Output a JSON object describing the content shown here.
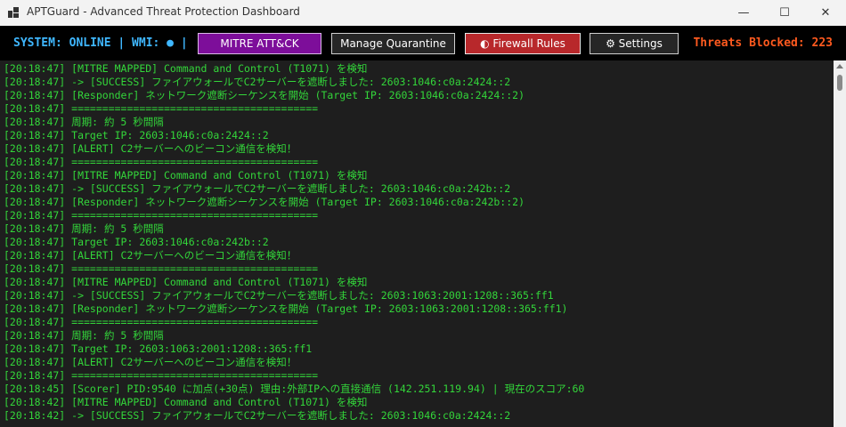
{
  "window": {
    "title": "APTGuard - Advanced Threat Protection Dashboard",
    "minimize_glyph": "—",
    "maximize_glyph": "☐",
    "close_glyph": "✕"
  },
  "toolbar": {
    "status_text": "SYSTEM: ONLINE | WMI: ● |",
    "mitre_label": "MITRE ATT&CK",
    "quarantine_label": "Manage Quarantine",
    "firewall_label": "◐ Firewall Rules",
    "settings_label": "⚙ Settings",
    "threats_text": "Threats Blocked: 223"
  },
  "colors": {
    "log_text": "#33d63a",
    "status_text": "#3fb7ff",
    "threats_text": "#ff5a1f",
    "mitre_button": "#7d0e9a",
    "firewall_button": "#b8282b"
  },
  "log_lines": [
    "[20:18:47] [MITRE MAPPED] Command and Control (T1071) を検知",
    "[20:18:47]   -> [SUCCESS] ファイアウォールでC2サーバーを遮断しました: 2603:1046:c0a:2424::2",
    "[20:18:47] [Responder] ネットワーク遮断シーケンスを開始 (Target IP: 2603:1046:c0a:2424::2)",
    "[20:18:47] ========================================",
    "[20:18:47]   周期: 約 5 秒間隔",
    "[20:18:47]   Target IP: 2603:1046:c0a:2424::2",
    "[20:18:47] [ALERT] C2サーバーへのビーコン通信を検知！",
    "[20:18:47] ========================================",
    "[20:18:47] [MITRE MAPPED] Command and Control (T1071) を検知",
    "[20:18:47]   -> [SUCCESS] ファイアウォールでC2サーバーを遮断しました: 2603:1046:c0a:242b::2",
    "[20:18:47] [Responder] ネットワーク遮断シーケンスを開始 (Target IP: 2603:1046:c0a:242b::2)",
    "[20:18:47] ========================================",
    "[20:18:47]   周期: 約 5 秒間隔",
    "[20:18:47]   Target IP: 2603:1046:c0a:242b::2",
    "[20:18:47] [ALERT] C2サーバーへのビーコン通信を検知！",
    "[20:18:47] ========================================",
    "[20:18:47] [MITRE MAPPED] Command and Control (T1071) を検知",
    "[20:18:47]   -> [SUCCESS] ファイアウォールでC2サーバーを遮断しました: 2603:1063:2001:1208::365:ff1",
    "[20:18:47] [Responder] ネットワーク遮断シーケンスを開始 (Target IP: 2603:1063:2001:1208::365:ff1)",
    "[20:18:47] ========================================",
    "[20:18:47]   周期: 約 5 秒間隔",
    "[20:18:47]   Target IP: 2603:1063:2001:1208::365:ff1",
    "[20:18:47] [ALERT] C2サーバーへのビーコン通信を検知！",
    "[20:18:47] ========================================",
    "[20:18:45] [Scorer] PID:9540 に加点(+30点) 理由:外部IPへの直接通信 (142.251.119.94) | 現在のスコア:60",
    "[20:18:42] [MITRE MAPPED] Command and Control (T1071) を検知",
    "[20:18:42]   -> [SUCCESS] ファイアウォールでC2サーバーを遮断しました: 2603:1046:c0a:2424::2"
  ]
}
